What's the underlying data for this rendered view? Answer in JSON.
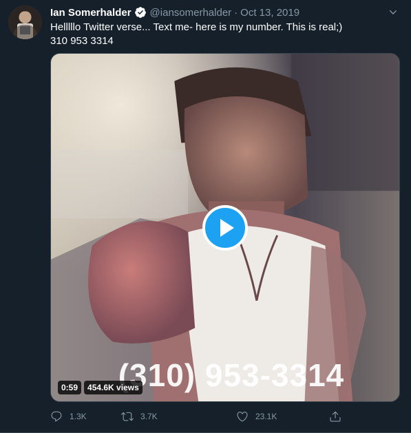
{
  "tweet": {
    "author_name": "Ian Somerhalder",
    "handle": "@iansomerhalder",
    "separator": "·",
    "date": "Oct 13, 2019",
    "text_line1": "Helllllo Twitter verse... Text me- here is my number. This is real;)",
    "text_line2": "310 953 3314"
  },
  "media": {
    "overlay_text": "(310) 953-3314",
    "duration": "0:59",
    "views": "454.6K views"
  },
  "actions": {
    "replies": "1.3K",
    "retweets": "3.7K",
    "likes": "23.1K"
  },
  "icons": {
    "verified": "verified-badge-icon",
    "caret": "chevron-down-icon",
    "play": "play-icon",
    "reply": "reply-icon",
    "retweet": "retweet-icon",
    "like": "heart-icon",
    "share": "share-icon"
  },
  "colors": {
    "background": "#15202b",
    "accent": "#1da1f2",
    "muted": "#8899a6",
    "border": "#38444d"
  }
}
